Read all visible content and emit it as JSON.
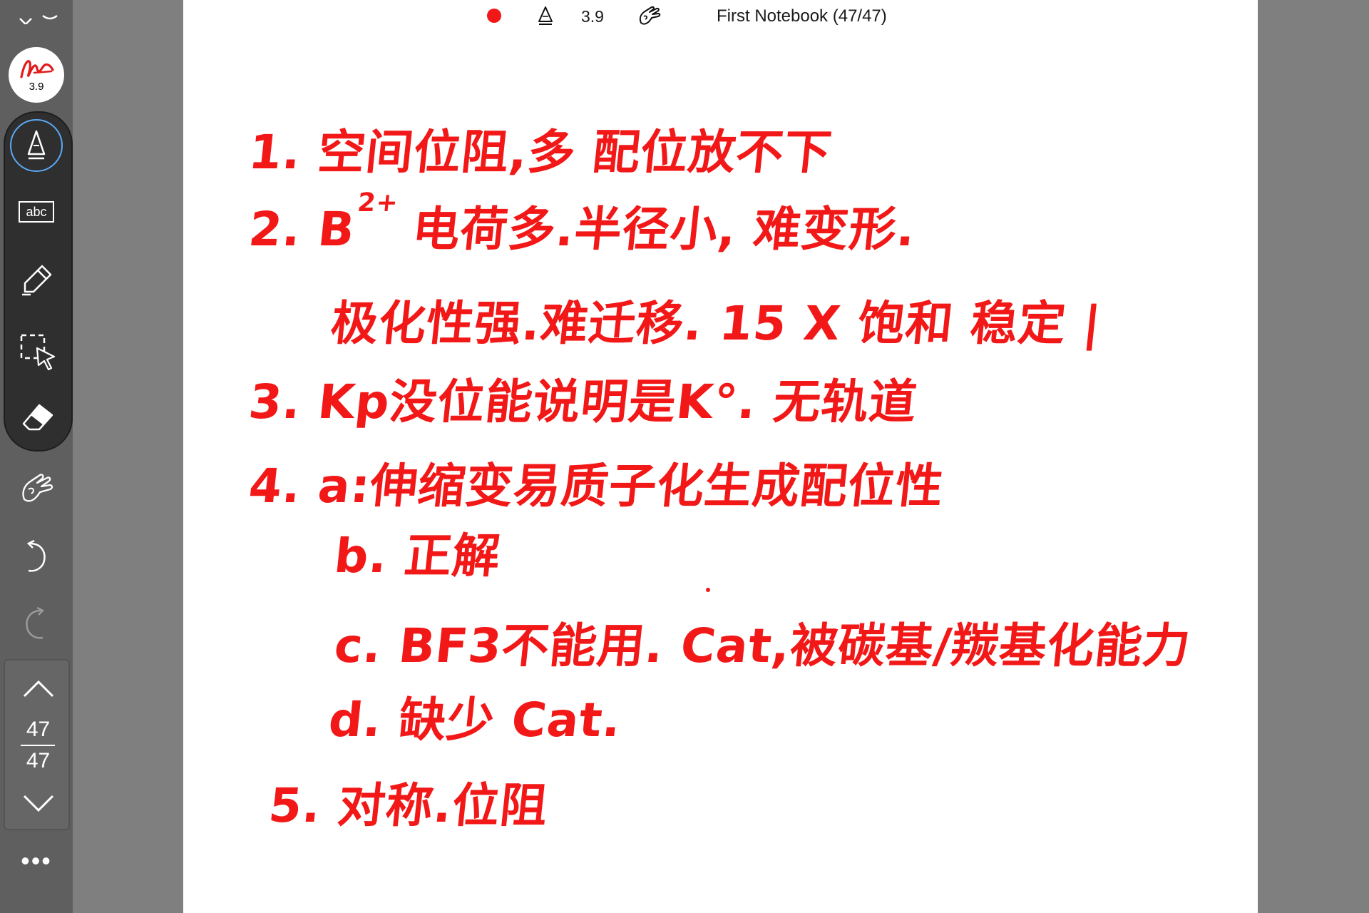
{
  "app": {
    "notebook_title": "First Notebook (47/47)",
    "pen_size": "3.9",
    "pen_color": "#f21818"
  },
  "sidebar": {
    "avatar_size": "3.9",
    "tools": [
      {
        "name": "pen-tool",
        "icon": "pen-icon",
        "selected": true
      },
      {
        "name": "text-tool",
        "label": "abc",
        "icon": "text-box-icon"
      },
      {
        "name": "highlighter-tool",
        "icon": "highlighter-icon"
      },
      {
        "name": "lasso-select-tool",
        "icon": "lasso-select-icon"
      },
      {
        "name": "eraser-tool",
        "icon": "eraser-icon"
      }
    ],
    "extra": [
      {
        "name": "hand-tool",
        "icon": "hand-touch-icon"
      },
      {
        "name": "undo",
        "icon": "undo-icon"
      },
      {
        "name": "redo",
        "icon": "redo-icon",
        "disabled": true
      }
    ],
    "page_nav": {
      "current": "47",
      "total": "47"
    },
    "more": "•••"
  },
  "note": {
    "lines": [
      "1. 空间位阻,多 配位放不下",
      "2.   B",
      "极化性强.难迁移. 15 X 饱和 稳定 |",
      "3. Kp没位能说明是K°. 无轨道",
      "4. a:伸缩变易质子化生成配位性",
      "b. 正解",
      "c. BF3不能用. Cat,被碳基/羰基化能力",
      "d. 缺少 Cat.",
      "5. 对称.位阻"
    ],
    "line2_sup": "2+",
    "line2_rest": " 电荷多.半径小, 难变形."
  },
  "colors": {
    "ink": "#f21818",
    "record_dot": "#f21818",
    "selected_ring": "#5aa9f5",
    "toolbar_bg": "#2f2f2f"
  }
}
